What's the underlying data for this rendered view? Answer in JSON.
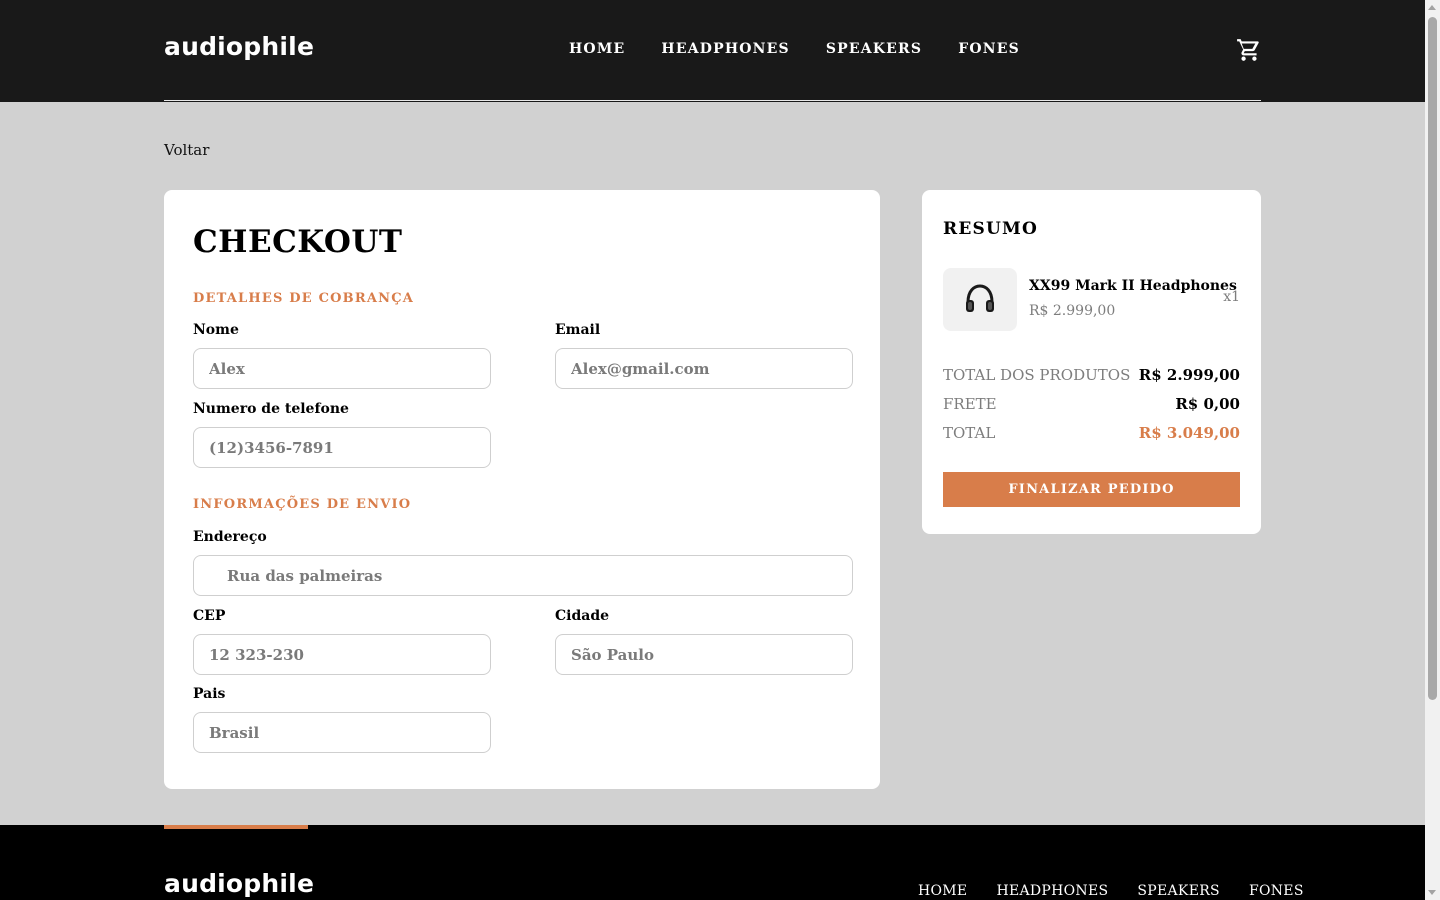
{
  "header": {
    "logo": "audiophile",
    "nav": [
      "HOME",
      "HEADPHONES",
      "SPEAKERS",
      "FONES"
    ],
    "cart_icon": "cart-icon"
  },
  "back_link": "Voltar",
  "checkout": {
    "title": "CHECKOUT",
    "billing": {
      "title": "DETALHES DE COBRANÇA",
      "name_label": "Nome",
      "name_value": "Alex",
      "email_label": "Email",
      "email_value": "Alex@gmail.com",
      "phone_label": "Numero de telefone",
      "phone_value": "(12)3456-7891"
    },
    "shipping": {
      "title": "INFORMAÇÕES DE ENVIO",
      "address_label": "Endereço",
      "address_value": "Rua das palmeiras",
      "cep_label": "CEP",
      "cep_value": "12 323-230",
      "city_label": "Cidade",
      "city_value": "São Paulo",
      "country_label": "Pais",
      "country_value": "Brasil"
    }
  },
  "summary": {
    "title": "RESUMO",
    "item": {
      "name": "XX99 Mark II Headphones",
      "price": "R$ 2.999,00",
      "qty": "x1",
      "icon": "headphones-icon"
    },
    "totals": [
      {
        "label": "TOTAL DOS PRODUTOS",
        "value": "R$ 2.999,00"
      },
      {
        "label": "FRETE",
        "value": "R$ 0,00"
      },
      {
        "label": "TOTAL",
        "value": "R$ 3.049,00"
      }
    ],
    "button": "FINALIZAR PEDIDO"
  },
  "footer": {
    "logo": "audiophile",
    "nav": [
      "HOME",
      "HEADPHONES",
      "SPEAKERS",
      "FONES"
    ]
  },
  "colors": {
    "accent": "#d87d4a",
    "header_bg": "#191919",
    "page_bg": "#d1d1d1"
  }
}
